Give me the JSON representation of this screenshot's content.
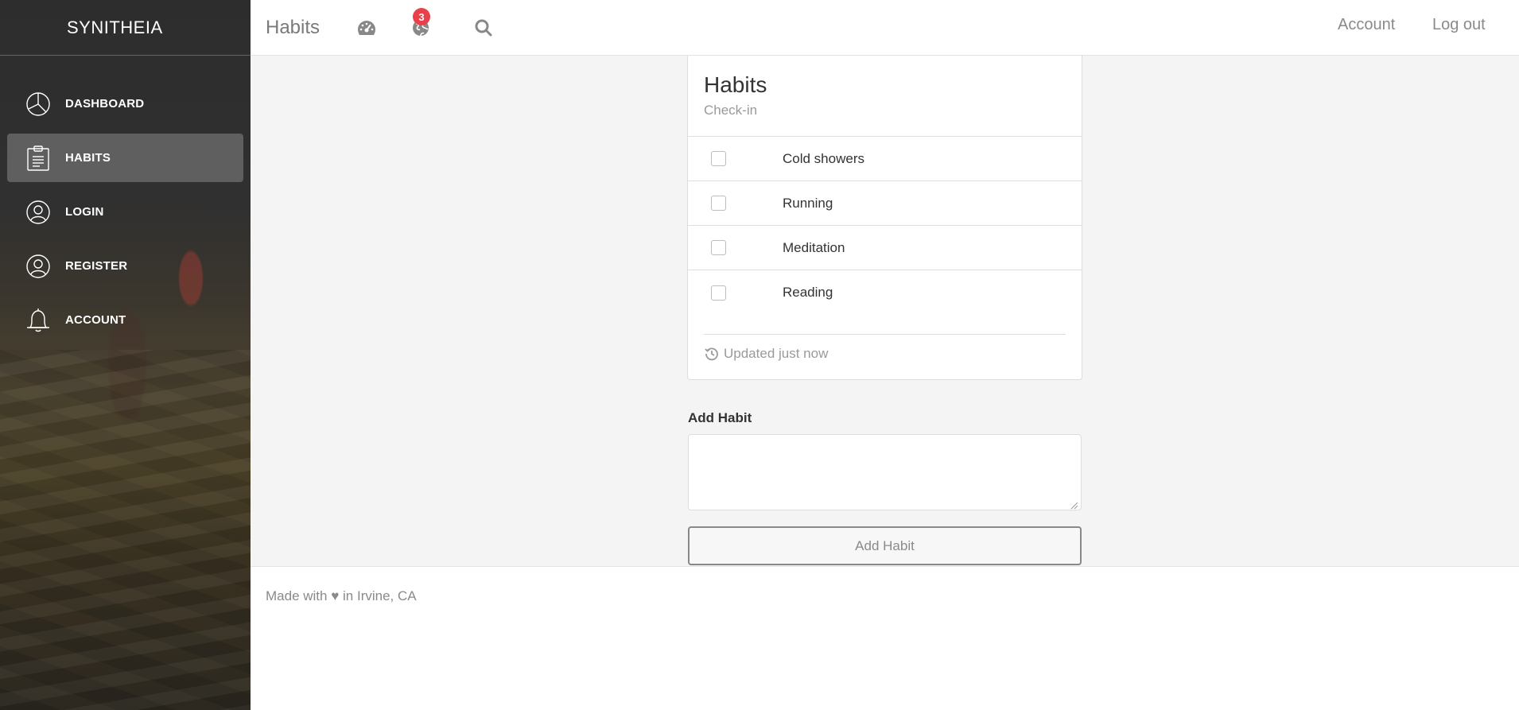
{
  "sidebar": {
    "brand": "SYNITHEIA",
    "items": [
      {
        "label": "DASHBOARD",
        "icon": "pie-chart-icon",
        "active": false
      },
      {
        "label": "HABITS",
        "icon": "clipboard-icon",
        "active": true
      },
      {
        "label": "LOGIN",
        "icon": "user-circle-icon",
        "active": false
      },
      {
        "label": "REGISTER",
        "icon": "user-circle-icon",
        "active": false
      },
      {
        "label": "ACCOUNT",
        "icon": "bell-icon",
        "active": false
      }
    ]
  },
  "topbar": {
    "title": "Habits",
    "icons": [
      "dashboard-gauge-icon",
      "globe-icon",
      "search-icon"
    ],
    "notification_count": "3",
    "links": {
      "account": "Account",
      "logout": "Log out"
    }
  },
  "card": {
    "title": "Habits",
    "subtitle": "Check-in",
    "habits": [
      {
        "name": "Cold showers",
        "checked": false
      },
      {
        "name": "Running",
        "checked": false
      },
      {
        "name": "Meditation",
        "checked": false
      },
      {
        "name": "Reading",
        "checked": false
      }
    ],
    "footer": "Updated just now"
  },
  "add_habit": {
    "label": "Add Habit",
    "textarea_value": "",
    "button_label": "Add Habit"
  },
  "footer": {
    "text": "Made with ♥ in Irvine, CA"
  },
  "colors": {
    "badge": "#e8414b",
    "sidebar_bg": "#2d2d2d",
    "muted_text": "#8a8a8a"
  }
}
